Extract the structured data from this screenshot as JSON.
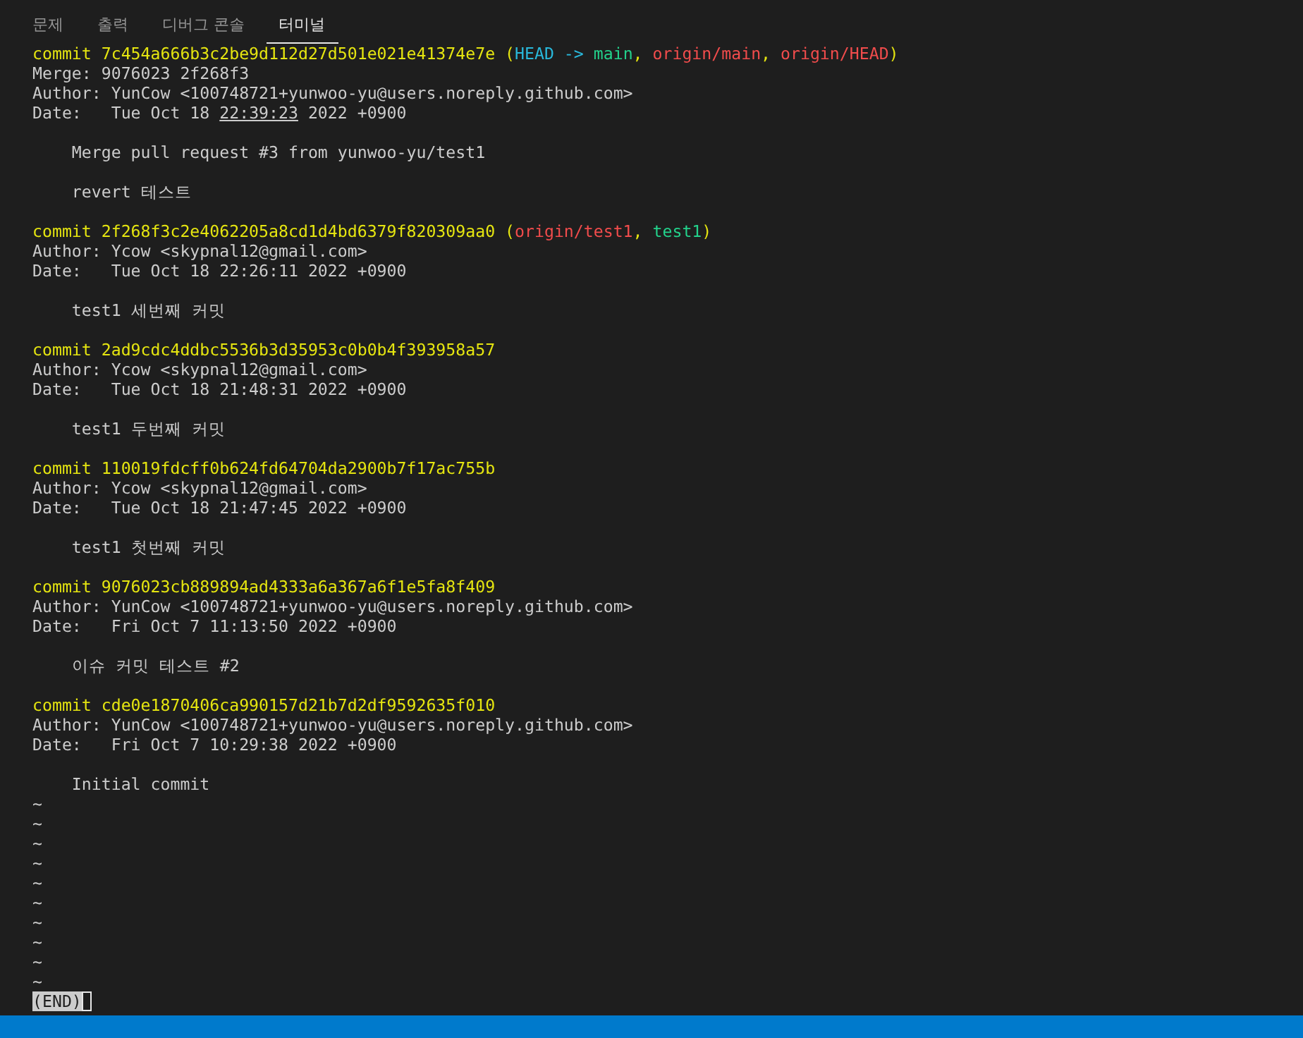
{
  "tabs": [
    {
      "label": "문제",
      "selected": false
    },
    {
      "label": "출력",
      "selected": false
    },
    {
      "label": "디버그 콘솔",
      "selected": false
    },
    {
      "label": "터미널",
      "selected": true
    }
  ],
  "terminal": {
    "lines": [
      {
        "kind": "commit",
        "segments": [
          {
            "text": "commit 7c454a666b3c2be9d112d27d501e021e41374e7e (",
            "color": "#e5e510"
          },
          {
            "text": "HEAD -> ",
            "color": "#29b8db"
          },
          {
            "text": "main",
            "color": "#23d18b"
          },
          {
            "text": ", ",
            "color": "#e5e510"
          },
          {
            "text": "origin/main",
            "color": "#f14c4c"
          },
          {
            "text": ", ",
            "color": "#e5e510"
          },
          {
            "text": "origin/HEAD",
            "color": "#f14c4c"
          },
          {
            "text": ")",
            "color": "#e5e510"
          }
        ]
      },
      {
        "kind": "meta",
        "text": "Merge: 9076023 2f268f3"
      },
      {
        "kind": "meta",
        "text": "Author: YunCow <100748721+yunwoo-yu@users.noreply.github.com>"
      },
      {
        "kind": "meta",
        "segments": [
          {
            "text": "Date:   Tue Oct 18 ",
            "underlined": false
          },
          {
            "text": "22:39:23",
            "underlined": true
          },
          {
            "text": " 2022 +0900",
            "underlined": false
          }
        ]
      },
      {
        "kind": "blank"
      },
      {
        "kind": "message",
        "text": "    Merge pull request #3 from yunwoo-yu/test1"
      },
      {
        "kind": "blank"
      },
      {
        "kind": "message",
        "text": "    revert 테스트"
      },
      {
        "kind": "blank"
      },
      {
        "kind": "commit",
        "segments": [
          {
            "text": "commit 2f268f3c2e4062205a8cd1d4bd6379f820309aa0 (",
            "color": "#e5e510"
          },
          {
            "text": "origin/test1",
            "color": "#f14c4c"
          },
          {
            "text": ", ",
            "color": "#e5e510"
          },
          {
            "text": "test1",
            "color": "#23d18b"
          },
          {
            "text": ")",
            "color": "#e5e510"
          }
        ]
      },
      {
        "kind": "meta",
        "text": "Author: Ycow <skypnal12@gmail.com>"
      },
      {
        "kind": "meta",
        "text": "Date:   Tue Oct 18 22:26:11 2022 +0900"
      },
      {
        "kind": "blank"
      },
      {
        "kind": "message",
        "text": "    test1 세번째 커밋"
      },
      {
        "kind": "blank"
      },
      {
        "kind": "commit",
        "segments": [
          {
            "text": "commit 2ad9cdc4ddbc5536b3d35953c0b0b4f393958a57",
            "color": "#e5e510"
          }
        ]
      },
      {
        "kind": "meta",
        "text": "Author: Ycow <skypnal12@gmail.com>"
      },
      {
        "kind": "meta",
        "text": "Date:   Tue Oct 18 21:48:31 2022 +0900"
      },
      {
        "kind": "blank"
      },
      {
        "kind": "message",
        "text": "    test1 두번째 커밋"
      },
      {
        "kind": "blank"
      },
      {
        "kind": "commit",
        "segments": [
          {
            "text": "commit 110019fdcff0b624fd64704da2900b7f17ac755b",
            "color": "#e5e510"
          }
        ]
      },
      {
        "kind": "meta",
        "text": "Author: Ycow <skypnal12@gmail.com>"
      },
      {
        "kind": "meta",
        "text": "Date:   Tue Oct 18 21:47:45 2022 +0900"
      },
      {
        "kind": "blank"
      },
      {
        "kind": "message",
        "text": "    test1 첫번째 커밋"
      },
      {
        "kind": "blank"
      },
      {
        "kind": "commit",
        "segments": [
          {
            "text": "commit 9076023cb889894ad4333a6a367a6f1e5fa8f409",
            "color": "#e5e510"
          }
        ]
      },
      {
        "kind": "meta",
        "text": "Author: YunCow <100748721+yunwoo-yu@users.noreply.github.com>"
      },
      {
        "kind": "meta",
        "text": "Date:   Fri Oct 7 11:13:50 2022 +0900"
      },
      {
        "kind": "blank"
      },
      {
        "kind": "message",
        "text": "    이슈 커밋 테스트 #2"
      },
      {
        "kind": "blank"
      },
      {
        "kind": "commit",
        "segments": [
          {
            "text": "commit cde0e1870406ca990157d21b7d2df9592635f010",
            "color": "#e5e510"
          }
        ]
      },
      {
        "kind": "meta",
        "text": "Author: YunCow <100748721+yunwoo-yu@users.noreply.github.com>"
      },
      {
        "kind": "meta",
        "text": "Date:   Fri Oct 7 10:29:38 2022 +0900"
      },
      {
        "kind": "blank"
      },
      {
        "kind": "message",
        "text": "    Initial commit"
      },
      {
        "kind": "tilde",
        "text": "~"
      },
      {
        "kind": "tilde",
        "text": "~"
      },
      {
        "kind": "tilde",
        "text": "~"
      },
      {
        "kind": "tilde",
        "text": "~"
      },
      {
        "kind": "tilde",
        "text": "~"
      },
      {
        "kind": "tilde",
        "text": "~"
      },
      {
        "kind": "tilde",
        "text": "~"
      },
      {
        "kind": "tilde",
        "text": "~"
      },
      {
        "kind": "tilde",
        "text": "~"
      },
      {
        "kind": "tilde",
        "text": "~"
      },
      {
        "kind": "pager",
        "text": "(END)"
      }
    ]
  }
}
